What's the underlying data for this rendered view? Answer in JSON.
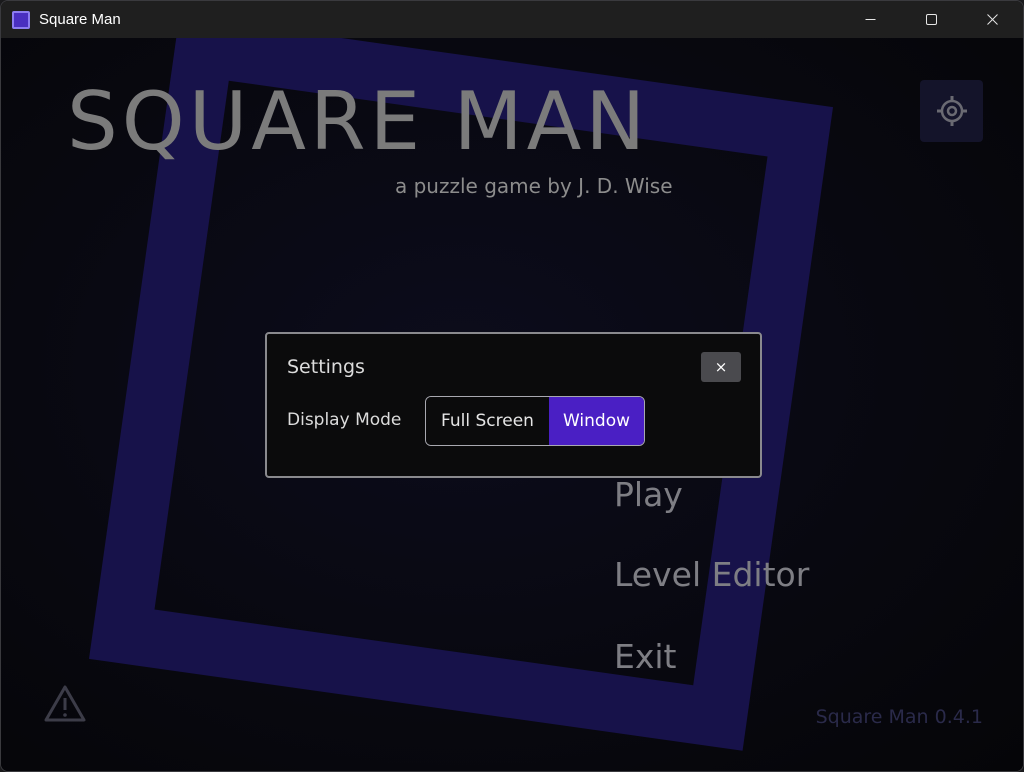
{
  "window": {
    "title": "Square Man",
    "controls": {
      "minimize": "─",
      "maximize": "☐",
      "close": "✕"
    }
  },
  "game": {
    "title": "SQUARE MAN",
    "subtitle": "a puzzle game by J. D. Wise",
    "menu": [
      "Play",
      "Level Editor",
      "Exit"
    ],
    "version": "Square Man 0.4.1"
  },
  "settings_dialog": {
    "title": "Settings",
    "close_label": "×",
    "display_mode_label": "Display Mode",
    "options": [
      "Full Screen",
      "Window"
    ],
    "selected": "Window"
  },
  "colors": {
    "accent": "#4a1fc4",
    "background_square": "#17124a"
  },
  "icons": {
    "app": "app-icon",
    "settings": "gear-icon",
    "warning": "warning-icon"
  }
}
